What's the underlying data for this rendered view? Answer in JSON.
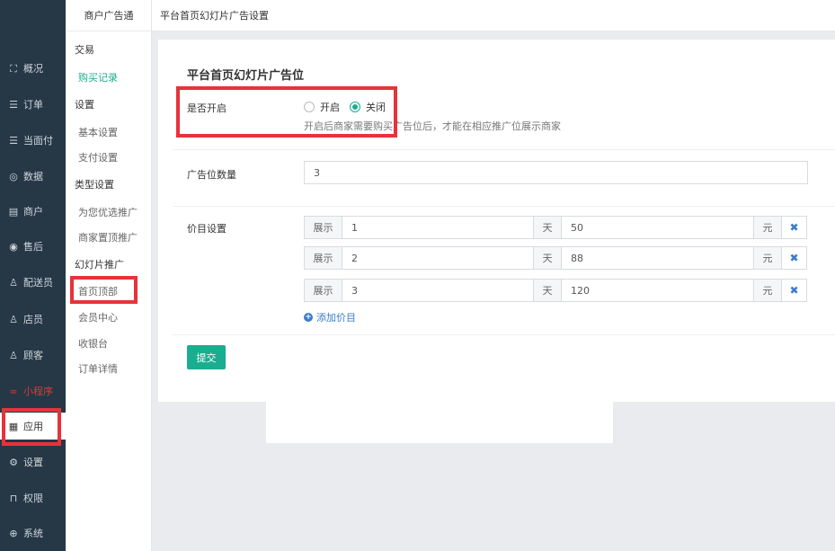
{
  "nav": {
    "items": [
      {
        "label": "概况",
        "icon": "overview-icon"
      },
      {
        "label": "订单",
        "icon": "order-icon"
      },
      {
        "label": "当面付",
        "icon": "pay-icon"
      },
      {
        "label": "数据",
        "icon": "data-icon"
      },
      {
        "label": "商户",
        "icon": "merchant-icon"
      },
      {
        "label": "售后",
        "icon": "aftersale-icon"
      },
      {
        "label": "配送员",
        "icon": "courier-icon"
      },
      {
        "label": "店员",
        "icon": "clerk-icon"
      },
      {
        "label": "顾客",
        "icon": "customer-icon"
      },
      {
        "label": "小程序",
        "icon": "miniprogram-icon"
      },
      {
        "label": "应用",
        "icon": "apps-icon"
      },
      {
        "label": "设置",
        "icon": "settings-icon"
      },
      {
        "label": "权限",
        "icon": "lock-icon"
      },
      {
        "label": "系统",
        "icon": "system-icon"
      }
    ]
  },
  "subnav": {
    "title": "商户广告通",
    "groups": [
      {
        "title": "交易",
        "items": [
          "购买记录"
        ]
      },
      {
        "title": "设置",
        "items": [
          "基本设置",
          "支付设置"
        ]
      },
      {
        "title": "类型设置",
        "items": [
          "为您优选推广",
          "商家置顶推广"
        ]
      },
      {
        "title": "幻灯片推广",
        "items": [
          "首页顶部",
          "会员中心",
          "收银台",
          "订单详情"
        ]
      }
    ]
  },
  "header": {
    "title": "平台首页幻灯片广告设置"
  },
  "form": {
    "title": "平台首页幻灯片广告位",
    "enable_label": "是否开启",
    "radio_on": "开启",
    "radio_off": "关闭",
    "enable_hint": "开启后商家需要购买广告位后，才能在相应推广位展示商家",
    "count_label": "广告位数量",
    "count_value": "3",
    "price_label": "价目设置",
    "price_rows": [
      {
        "prefix": "展示",
        "days": "1",
        "unit_day": "天",
        "price": "50",
        "unit_price": "元"
      },
      {
        "prefix": "展示",
        "days": "2",
        "unit_day": "天",
        "price": "88",
        "unit_price": "元"
      },
      {
        "prefix": "展示",
        "days": "3",
        "unit_day": "天",
        "price": "120",
        "unit_price": "元"
      }
    ],
    "add_label": "添加价目",
    "submit_label": "提交"
  },
  "colors": {
    "accent": "#1aad8f",
    "nav_bg": "#263746",
    "annotation": "#e8323a",
    "link": "#3a7dc9"
  }
}
